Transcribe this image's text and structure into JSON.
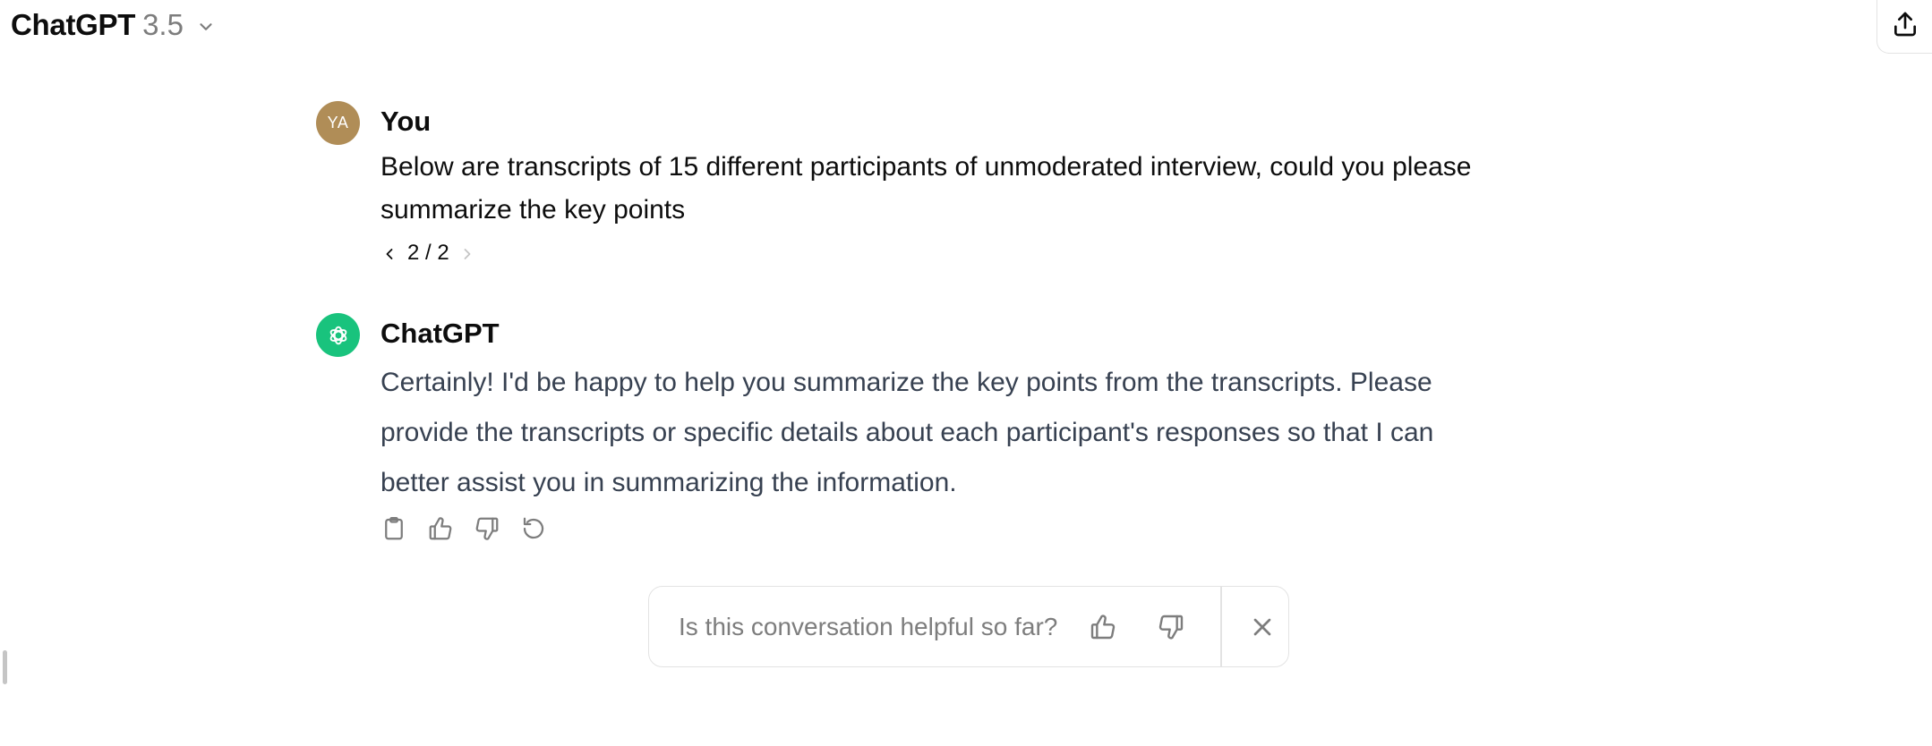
{
  "header": {
    "model_name": "ChatGPT",
    "model_version": "3.5",
    "switcher_icon": "chevron-down-icon",
    "share_icon": "upload-icon"
  },
  "conversation": {
    "user_message": {
      "avatar_initials": "YA",
      "avatar_color": "#b08d57",
      "author": "You",
      "text": "Below are transcripts of 15 different participants of unmoderated interview, could you please summarize the key points",
      "pager": "2 / 2"
    },
    "assistant_message": {
      "avatar_icon": "openai-logo-icon",
      "avatar_color": "#19c37d",
      "author": "ChatGPT",
      "text": "Certainly! I'd be happy to help you summarize the key points from the transcripts. Please provide the transcripts or specific details about each participant's responses so that I can better assist you in summarizing the information.",
      "actions": [
        "copy-icon",
        "thumbs-up-icon",
        "thumbs-down-icon",
        "regenerate-icon"
      ]
    }
  },
  "feedback": {
    "question": "Is this conversation helpful so far?",
    "icons": [
      "thumbs-up-icon",
      "thumbs-down-icon",
      "close-icon"
    ]
  }
}
